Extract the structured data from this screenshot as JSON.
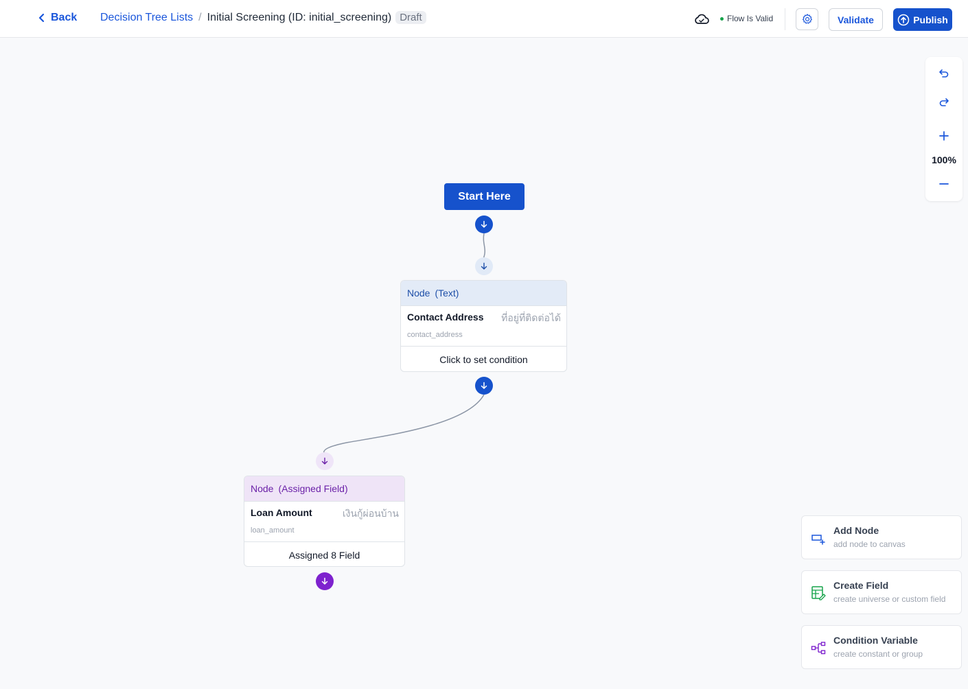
{
  "header": {
    "back_label": "Back",
    "breadcrumb_root": "Decision Tree Lists",
    "breadcrumb_sep": "/",
    "page_title": "Initial Screening (ID: initial_screening)",
    "status_badge": "Draft",
    "flow_status": "Flow Is Valid",
    "validate_label": "Validate",
    "publish_label": "Publish"
  },
  "zoom": {
    "level": "100%"
  },
  "canvas": {
    "start_label": "Start Here",
    "nodes": [
      {
        "kind": "text",
        "header": "Node",
        "type": "(Text)",
        "label": "Contact Address",
        "thai": "ที่อยู่ที่ติดต่อได้",
        "key": "contact_address",
        "footer": "Click to set condition"
      },
      {
        "kind": "assigned",
        "header": "Node",
        "type": "(Assigned Field)",
        "label": "Loan Amount",
        "thai": "เงินกู้ผ่อนบ้าน",
        "key": "loan_amount",
        "footer": "Assigned 8 Field"
      }
    ]
  },
  "actions": [
    {
      "title": "Add Node",
      "subtitle": "add node to canvas",
      "icon": "add-node-icon"
    },
    {
      "title": "Create Field",
      "subtitle": "create universe or custom field",
      "icon": "create-field-icon"
    },
    {
      "title": "Condition Variable",
      "subtitle": "create constant or group",
      "icon": "condition-variable-icon"
    }
  ],
  "colors": {
    "primary": "#1652cc",
    "assigned_accent": "#7e22ce",
    "valid": "#16a34a",
    "field_green": "#16a34a"
  }
}
